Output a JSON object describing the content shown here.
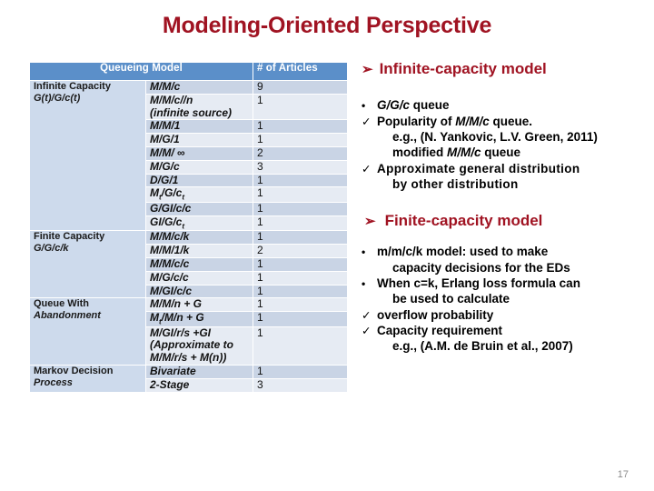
{
  "slide": {
    "title": "Modeling-Oriented Perspective",
    "number": "17",
    "accent_red": "#A01322",
    "header_blue": "#5B8FC9",
    "category_cell_blue": "#CDDAEC",
    "row_dark": "#C9D4E5",
    "row_light": "#E6EBF3"
  },
  "table": {
    "headers": {
      "model": "Queueing Model",
      "articles": "# of Articles"
    },
    "groups": [
      {
        "category_main": "Infinite Capacity",
        "category_sub": "G(t)/G/c(t)",
        "rows": [
          {
            "model": "M/M/c",
            "articles": "9"
          },
          {
            "model": "M/M/c//n",
            "model_line2": "(infinite source)",
            "articles": "1"
          },
          {
            "model": "M/M/1",
            "articles": "1"
          },
          {
            "model": "M/G/1",
            "articles": "1"
          },
          {
            "model": "M/M/ ∞",
            "articles": "2"
          },
          {
            "model": "M/G/c",
            "articles": "3"
          },
          {
            "model": "D/G/1",
            "articles": "1"
          },
          {
            "model": "Mt/G/ct",
            "articles": "1"
          },
          {
            "model": "G/GI/c/c",
            "articles": "1"
          },
          {
            "model": "GI/G/ct",
            "articles": "1"
          }
        ]
      },
      {
        "category_main": "Finite Capacity",
        "category_sub": "G/G/c/k",
        "rows": [
          {
            "model": "M/M/c/k",
            "articles": "1"
          },
          {
            "model": "M/M/1/k",
            "articles": "2"
          },
          {
            "model": "M/M/c/c",
            "articles": "1"
          },
          {
            "model": "M/G/c/c",
            "articles": "1"
          },
          {
            "model": "M/GI/c/c",
            "articles": "1"
          }
        ]
      },
      {
        "category_main": "Queue With",
        "category_sub": "Abandonment",
        "rows": [
          {
            "model": "M/M/n + G",
            "articles": "1"
          },
          {
            "model": "Mt/M/n + G",
            "articles": "1"
          },
          {
            "model": "M/GI/r/s +GI",
            "model_line2": "(Approximate  to",
            "model_line3": "M/M/r/s + M(n))",
            "articles": "1"
          }
        ]
      },
      {
        "category_main": "Markov Decision",
        "category_sub": "Process",
        "rows": [
          {
            "model": "Bivariate",
            "articles": "1"
          },
          {
            "model": "2-Stage",
            "articles": "3"
          }
        ]
      }
    ]
  },
  "right_panel": {
    "infinite": {
      "heading": "Infinite-capacity model",
      "arrow": "➢",
      "lines": [
        {
          "mark": "•",
          "text": "G/G/c queue",
          "italic_part": "G/G/c",
          "plain_part": " queue"
        },
        {
          "mark": "✓",
          "text": "Popularity of M/M/c queue."
        },
        {
          "mark": "",
          "text": "e.g., (N. Yankovic, L.V. Green, 2011)"
        },
        {
          "mark": "",
          "text": "modified M/M/c queue"
        },
        {
          "mark": "✓",
          "text": "Approximate  general  distribution"
        },
        {
          "mark": "",
          "text": "by other distribution"
        }
      ]
    },
    "finite": {
      "heading": "Finite-capacity model",
      "arrow": "➢",
      "lines": [
        {
          "mark": "•",
          "text": "m/m/c/k model: used to make"
        },
        {
          "mark": "",
          "text": "capacity decisions for the EDs"
        },
        {
          "mark": "•",
          "text": "When c=k, Erlang loss formula can"
        },
        {
          "mark": "",
          "text": "be used to calculate"
        },
        {
          "mark": "✓",
          "text": "overflow probability"
        },
        {
          "mark": "✓",
          "text": "Capacity requirement"
        },
        {
          "mark": "",
          "text": "e.g., (A.M. de Bruin et al., 2007)"
        }
      ]
    }
  }
}
